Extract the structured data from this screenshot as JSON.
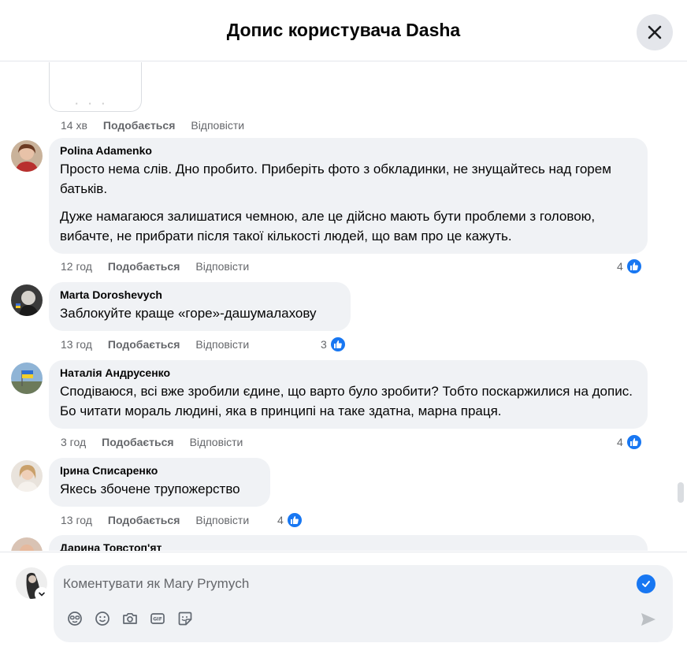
{
  "header": {
    "title": "Допис користувача Dasha",
    "close_icon": "close-icon"
  },
  "previous_comment": {
    "time": "14 хв",
    "like_label": "Подобається",
    "reply_label": "Відповісти"
  },
  "comments": [
    {
      "author": "Polina Adamenko",
      "paragraphs": [
        "Просто нема слів. Дно пробито. Приберіть фото з обкладинки, не знущайтесь над горем батьків.",
        "Дуже намагаюся залишатися чемною, але це дійсно мають бути проблеми з головою, вибачте, не прибрати після такої кількості людей, що вам про це кажуть."
      ],
      "time": "12 год",
      "like_label": "Подобається",
      "reply_label": "Відповісти",
      "reactions": "4"
    },
    {
      "author": "Marta Doroshevych",
      "paragraphs": [
        "Заблокуйте краще «горе»-дашумалахову"
      ],
      "time": "13 год",
      "like_label": "Подобається",
      "reply_label": "Відповісти",
      "reactions": "3"
    },
    {
      "author": "Наталія Андрусенко",
      "paragraphs": [
        "Сподіваюся, всі вже зробили єдине, що варто було зробити? Тобто поскаржилися на допис. Бо читати мораль людині, яка в принципі на таке здатна, марна праця."
      ],
      "time": "3 год",
      "like_label": "Подобається",
      "reply_label": "Відповісти",
      "reactions": "4"
    },
    {
      "author": "Ірина Списаренко",
      "paragraphs": [
        "Якесь збочене трупожерство"
      ],
      "time": "13 год",
      "like_label": "Подобається",
      "reply_label": "Відповісти",
      "reactions": "4"
    },
    {
      "author": "Дарина Товстоп'ят"
    }
  ],
  "composer": {
    "placeholder": "Коментувати як Mary Prymych",
    "tools": [
      "avatar-sticker-icon",
      "emoji-icon",
      "camera-icon",
      "gif-icon",
      "sticker-icon"
    ],
    "send_icon": "send-icon"
  },
  "colors": {
    "accent": "#1877f2",
    "bubble": "#f0f2f5",
    "secondary_text": "#65676b"
  }
}
